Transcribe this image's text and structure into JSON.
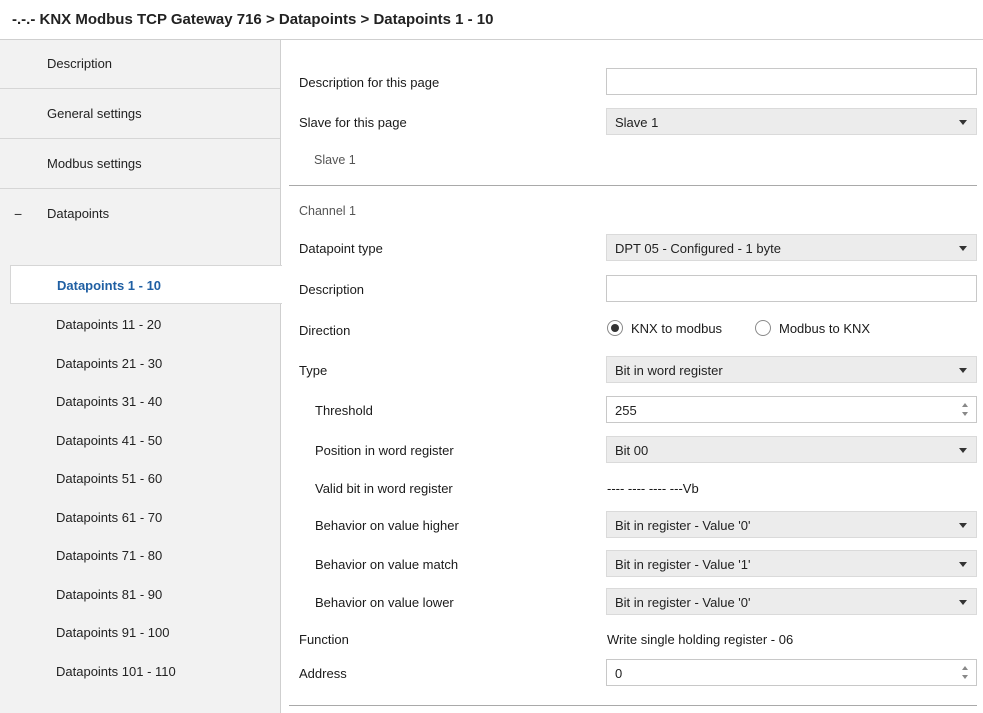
{
  "window": {
    "title": "-.-.- KNX Modbus TCP Gateway 716 > Datapoints > Datapoints 1 - 10"
  },
  "sidebar": {
    "items": [
      {
        "label": "Description"
      },
      {
        "label": "General settings"
      },
      {
        "label": "Modbus settings"
      },
      {
        "label": "Datapoints",
        "expander": "−"
      }
    ],
    "subitems": [
      {
        "label": "Datapoints 1 - 10"
      },
      {
        "label": "Datapoints 11 - 20"
      },
      {
        "label": "Datapoints 21 - 30"
      },
      {
        "label": "Datapoints 31 - 40"
      },
      {
        "label": "Datapoints 41 - 50"
      },
      {
        "label": "Datapoints 51 - 60"
      },
      {
        "label": "Datapoints 61 - 70"
      },
      {
        "label": "Datapoints 71 - 80"
      },
      {
        "label": "Datapoints 81 - 90"
      },
      {
        "label": "Datapoints 91 - 100"
      },
      {
        "label": "Datapoints 101 - 110"
      }
    ]
  },
  "page": {
    "description_label": "Description for this page",
    "description_value": "",
    "slave_label": "Slave for this page",
    "slave_value": "Slave 1",
    "slave_info": "Slave 1"
  },
  "channel": {
    "heading": "Channel 1",
    "datapoint_type_label": "Datapoint type",
    "datapoint_type_value": "DPT 05 - Configured - 1 byte",
    "description_label": "Description",
    "description_value": "",
    "direction_label": "Direction",
    "direction_options": [
      "KNX to modbus",
      "Modbus to KNX"
    ],
    "type_label": "Type",
    "type_value": "Bit in word register",
    "threshold_label": "Threshold",
    "threshold_value": "255",
    "position_label": "Position in word register",
    "position_value": "Bit 00",
    "valid_bit_label": "Valid bit in word register",
    "valid_bit_value": "---- ---- ---- ---Vb",
    "higher_label": "Behavior on value higher",
    "higher_value": "Bit in register - Value '0'",
    "match_label": "Behavior on value match",
    "match_value": "Bit in register - Value '1'",
    "lower_label": "Behavior on value lower",
    "lower_value": "Bit in register - Value '0'",
    "function_label": "Function",
    "function_value": "Write single holding register - 06",
    "address_label": "Address",
    "address_value": "0"
  }
}
